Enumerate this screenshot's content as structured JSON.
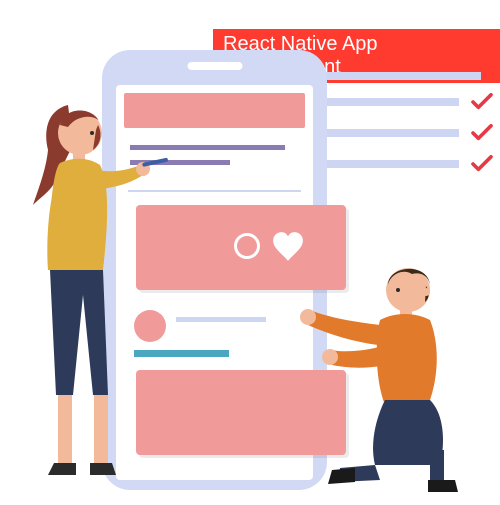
{
  "title": "React Native App Development",
  "checklist": {
    "items": [
      {
        "checked": false
      },
      {
        "checked": true
      },
      {
        "checked": true
      },
      {
        "checked": true
      }
    ]
  },
  "colors": {
    "accent_red": "#ff3b30",
    "phone_frame": "#d2d9f5",
    "card": "#f19a9a",
    "line": "#cdd5f2",
    "progress": "#4aa7c1",
    "check": "#e63946"
  }
}
